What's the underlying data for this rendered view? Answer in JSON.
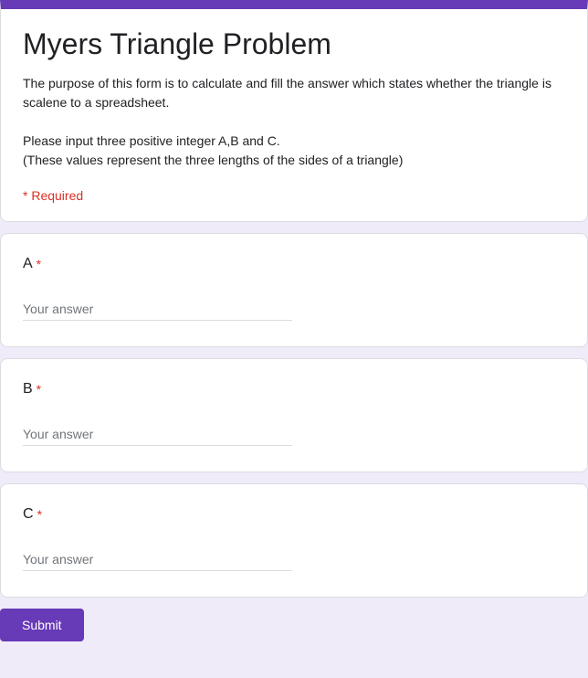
{
  "form": {
    "title": "Myers Triangle Problem",
    "description_line1": "The purpose of this form is to calculate and fill the answer which states whether the triangle is scalene to a spreadsheet.",
    "description_line2": "Please input three positive integer A,B and C.",
    "description_line3": "(These values represent the three lengths of the sides of a triangle)",
    "required_note": "* Required"
  },
  "questions": {
    "a": {
      "label": "A",
      "placeholder": "Your answer"
    },
    "b": {
      "label": "B",
      "placeholder": "Your answer"
    },
    "c": {
      "label": "C",
      "placeholder": "Your answer"
    }
  },
  "actions": {
    "submit_label": "Submit"
  }
}
